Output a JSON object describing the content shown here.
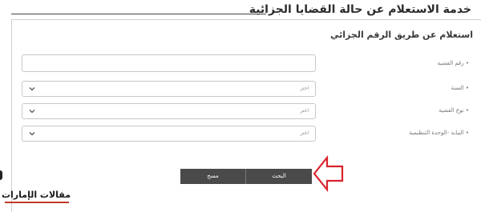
{
  "header": {
    "title": "خدمة الاستعلام عن حالة القضايا الجزائية"
  },
  "section": {
    "title": "استعلام عن طريق الرقم الجزائي"
  },
  "form": {
    "case_number": {
      "label": "• رقم القضية",
      "value": ""
    },
    "year": {
      "label": "• السنة",
      "selected": "اختر"
    },
    "case_type": {
      "label": "• نوع القضية",
      "selected": "اختر"
    },
    "prosecution": {
      "label": "• النيابة -الوحدة التنظيمية",
      "selected": "اختر"
    }
  },
  "buttons": {
    "search_label": "البحث",
    "clear_label": "مسح"
  },
  "watermark": {
    "text": "مقالات الإمارات"
  },
  "colors": {
    "button_bg": "#4a4a4a",
    "arrow": "#d9232d",
    "watermark_accent": "#c0392b"
  },
  "icons": {
    "select_chevron": "chevron-down-icon",
    "pointer": "arrow-left-outline-icon"
  }
}
